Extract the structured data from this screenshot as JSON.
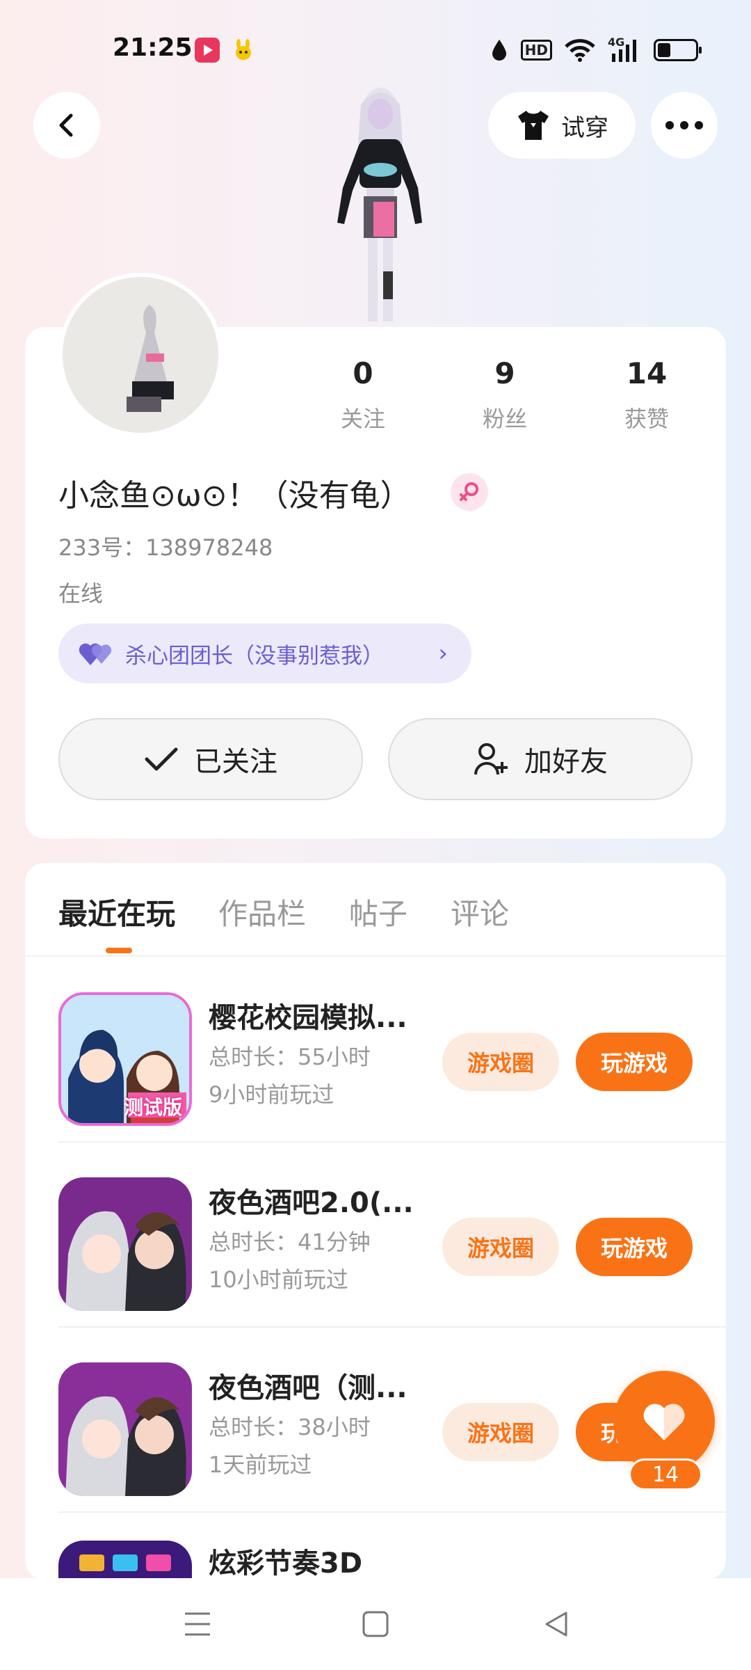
{
  "status_bar": {
    "time": "21:25",
    "hd": "HD",
    "network": "4G",
    "battery_level": 0.35,
    "icons": [
      "video-app-icon",
      "pet-app-icon",
      "water-drop-icon",
      "hd-icon",
      "wifi-icon",
      "signal-icon",
      "battery-icon"
    ]
  },
  "header": {
    "back_icon": "back-icon",
    "tryon_label": "试穿",
    "tryon_icon": "shirt-icon",
    "more_icon": "more-icon"
  },
  "profile": {
    "stats": [
      {
        "value": "0",
        "label": "关注"
      },
      {
        "value": "9",
        "label": "粉丝"
      },
      {
        "value": "14",
        "label": "获赞"
      }
    ],
    "nickname": "小念鱼⊙ω⊙！（没有龟）",
    "gender_icon": "female-icon",
    "user_id": "233号：138978248",
    "online_status": "在线",
    "title_chip": "杀心团团长（没事别惹我）",
    "follow_label": "已关注",
    "add_friend_label": "加好友"
  },
  "tabs": [
    {
      "label": "最近在玩",
      "active": true
    },
    {
      "label": "作品栏",
      "active": false
    },
    {
      "label": "帖子",
      "active": false
    },
    {
      "label": "评论",
      "active": false
    }
  ],
  "games": [
    {
      "name": "樱花校园模拟...",
      "duration": "总时长：55小时",
      "last_played": "9小时前玩过",
      "circle_label": "游戏圈",
      "play_label": "玩游戏",
      "icon": "sakura-school-icon"
    },
    {
      "name": "夜色酒吧2.0(...",
      "duration": "总时长：41分钟",
      "last_played": "10小时前玩过",
      "circle_label": "游戏圈",
      "play_label": "玩游戏",
      "icon": "night-bar-icon"
    },
    {
      "name": "夜色酒吧（测...",
      "duration": "总时长：38小时",
      "last_played": "1天前玩过",
      "circle_label": "游戏圈",
      "play_label": "玩游戏",
      "icon": "night-bar-test-icon"
    },
    {
      "name": "炫彩节奏3D",
      "duration": "",
      "last_played": "",
      "circle_label": "",
      "play_label": "",
      "icon": "rhythm-game-icon"
    }
  ],
  "like_fab": {
    "count": "14",
    "icon": "heart-icon"
  },
  "icon_badge_text": "测试版",
  "nav": [
    "menu-icon",
    "home-icon",
    "back-triangle-icon"
  ],
  "colors": {
    "accent": "#f97316",
    "accent_light": "#fdeadf",
    "chip_bg": "#ece9fb",
    "chip_text": "#6b5fd0"
  }
}
